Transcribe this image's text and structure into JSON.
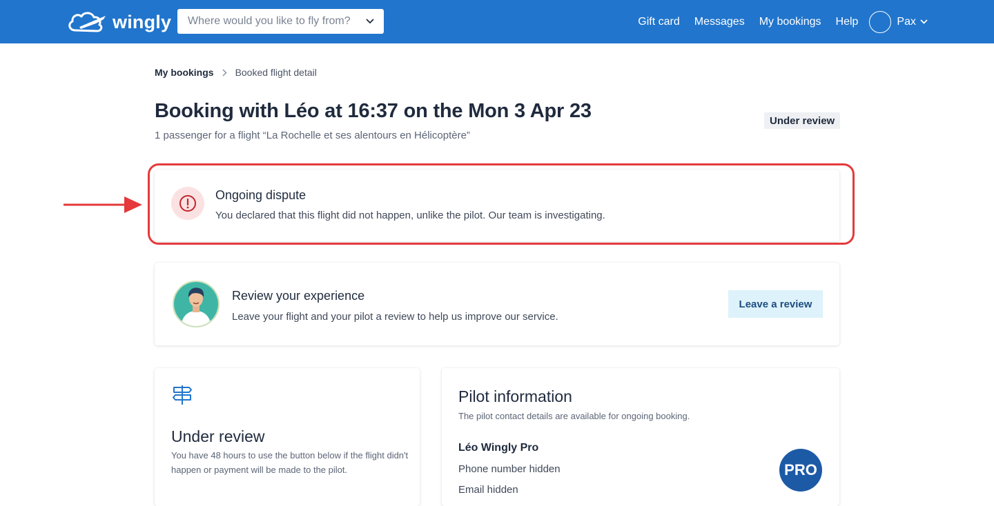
{
  "header": {
    "logo_text": "wingly",
    "search": {
      "placeholder": "Where would you like to fly from?"
    },
    "nav": {
      "gift_card": "Gift card",
      "messages": "Messages",
      "my_bookings": "My bookings",
      "help": "Help",
      "user_name": "Pax"
    }
  },
  "breadcrumb": {
    "root": "My bookings",
    "current": "Booked flight detail"
  },
  "booking": {
    "title": "Booking with Léo at 16:37 on the Mon 3 Apr 23",
    "subtitle": "1 passenger for a flight “La Rochelle et ses alentours en Hélicoptère”",
    "status": "Under review"
  },
  "dispute": {
    "title": "Ongoing dispute",
    "text": "You declared that this flight did not happen, unlike the pilot. Our team is investigating."
  },
  "review": {
    "title": "Review your experience",
    "text": "Leave your flight and your pilot a review to help us improve our service.",
    "button": "Leave a review"
  },
  "status_card": {
    "title": "Under review",
    "text": "You have 48 hours to use the button below if the flight didn't happen or payment will be made to the pilot."
  },
  "pilot": {
    "title": "Pilot information",
    "subtitle": "The pilot contact details are available for ongoing booking.",
    "name": "Léo Wingly Pro",
    "phone": "Phone number hidden",
    "email": "Email hidden",
    "badge": "PRO"
  },
  "colors": {
    "header_bg": "#2175cc",
    "annotation_red": "#e5393b",
    "review_button_bg": "#def2fb",
    "pro_badge_bg": "#1d5aa6"
  },
  "icons": [
    "cloud-plane-logo-icon",
    "chevron-down-icon",
    "chevron-right-icon",
    "exclamation-circle-icon",
    "signpost-icon",
    "arrow-right-icon"
  ]
}
